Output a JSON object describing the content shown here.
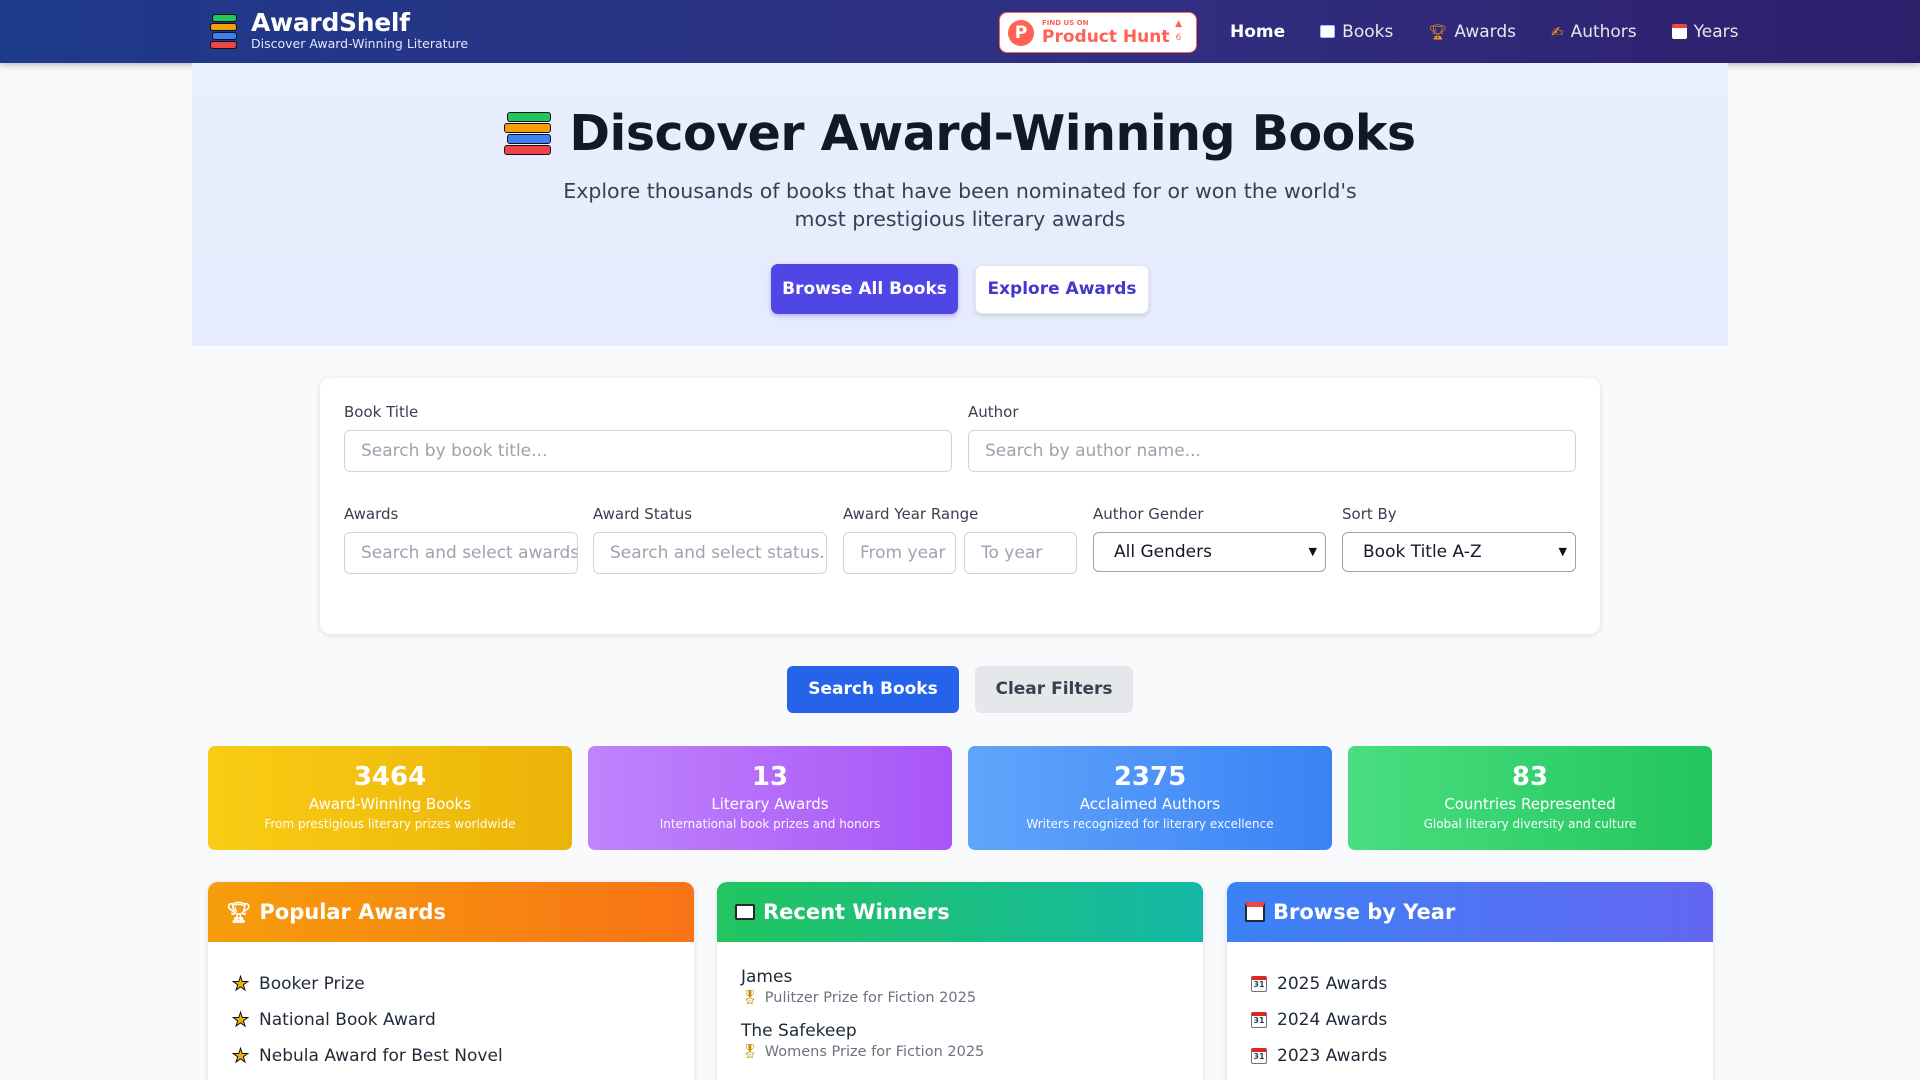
{
  "nav": {
    "brand_name": "AwardShelf",
    "brand_tagline": "Discover Award-Winning Literature",
    "product_hunt": {
      "small": "FIND US ON",
      "big": "Product Hunt",
      "votes": "6"
    },
    "links": [
      {
        "label": "Home",
        "icon": "",
        "active": true
      },
      {
        "label": "Books",
        "icon": "book-icon"
      },
      {
        "label": "Awards",
        "icon": "trophy-icon"
      },
      {
        "label": "Authors",
        "icon": "quill-icon"
      },
      {
        "label": "Years",
        "icon": "calendar-icon"
      }
    ]
  },
  "hero": {
    "title": "Discover Award-Winning Books",
    "subtitle_line1": "Explore thousands of books that have been nominated for or won the world's",
    "subtitle_line2": "most prestigious literary awards",
    "primary_button": "Browse All Books",
    "secondary_button": "Explore Awards"
  },
  "search": {
    "title_label": "Book Title",
    "title_placeholder": "Search by book title...",
    "author_label": "Author",
    "author_placeholder": "Search by author name...",
    "awards_label": "Awards",
    "awards_placeholder": "Search and select awards...",
    "status_label": "Award Status",
    "status_placeholder": "Search and select status...",
    "year_label": "Award Year Range",
    "from_placeholder": "From year",
    "to_placeholder": "To year",
    "gender_label": "Author Gender",
    "gender_value": "All Genders",
    "sort_label": "Sort By",
    "sort_value": "Book Title A-Z",
    "search_button": "Search Books",
    "clear_button": "Clear Filters"
  },
  "stats": [
    {
      "num": "3464",
      "label": "Award-Winning Books",
      "desc": "From prestigious literary prizes worldwide",
      "color_from": "#facc15",
      "color_to": "#eab308"
    },
    {
      "num": "13",
      "label": "Literary Awards",
      "desc": "International book prizes and honors",
      "color_from": "#c084fc",
      "color_to": "#a855f7"
    },
    {
      "num": "2375",
      "label": "Acclaimed Authors",
      "desc": "Writers recognized for literary excellence",
      "color_from": "#60a5fa",
      "color_to": "#3b82f6"
    },
    {
      "num": "83",
      "label": "Countries Represented",
      "desc": "Global literary diversity and culture",
      "color_from": "#4ade80",
      "color_to": "#22c55e"
    }
  ],
  "panels": {
    "popular": {
      "title": "Popular Awards",
      "items": [
        "Booker Prize",
        "National Book Award",
        "Nebula Award for Best Novel"
      ]
    },
    "recent": {
      "title": "Recent Winners",
      "items": [
        {
          "title": "James",
          "award": "Pulitzer Prize for Fiction 2025"
        },
        {
          "title": "The Safekeep",
          "award": "Womens Prize for Fiction 2025"
        }
      ]
    },
    "years": {
      "title": "Browse by Year",
      "items": [
        "2025 Awards",
        "2024 Awards",
        "2023 Awards"
      ]
    }
  }
}
